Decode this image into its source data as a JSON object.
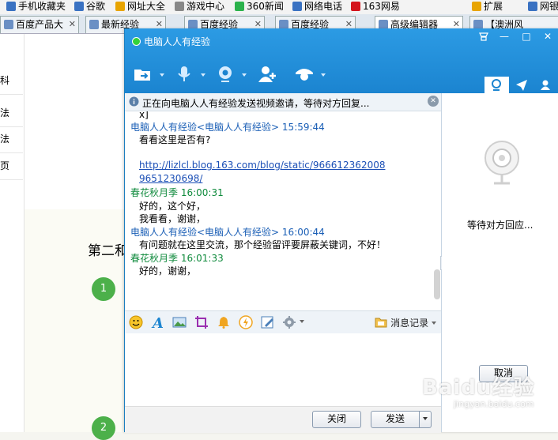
{
  "bookmarks": [
    {
      "label": "手机收藏夹",
      "color": "#3a72c2"
    },
    {
      "label": "谷歌",
      "color": "#3a72c2"
    },
    {
      "label": "网址大全",
      "color": "#e8a400"
    },
    {
      "label": "游戏中心",
      "color": "#888888"
    },
    {
      "label": "360新闻",
      "color": "#2bb24c"
    },
    {
      "label": "网络电话",
      "color": "#3a72c2"
    },
    {
      "label": "163网易",
      "color": "#d4141c"
    },
    {
      "label": "扩展",
      "color": "#e8a400"
    },
    {
      "label": "网银",
      "color": "#3a72c2"
    }
  ],
  "tabs": [
    {
      "label": "百度产品大",
      "close": "✕"
    },
    {
      "label": "最新经验",
      "close": "✕"
    },
    {
      "label": "百度经验",
      "close": "✕"
    },
    {
      "label": "百度经验",
      "close": "✕"
    },
    {
      "label": "高级编辑器",
      "close": "✕"
    },
    {
      "label": "【澳洲风",
      "close": ""
    }
  ],
  "background_page": {
    "nav_items": [
      "科",
      "法",
      "法",
      "页"
    ],
    "step_heading": "第二和",
    "step_numbers": [
      "1",
      "2"
    ]
  },
  "chat_window": {
    "title": "电脑人人有经验",
    "window_buttons": [
      "—",
      "□",
      "✕"
    ],
    "notice": "正在向电脑人人有经验发送视频邀请，等待对方回复...",
    "notice_close": "✕",
    "messages": [
      {
        "text": "x]",
        "style": "body"
      },
      {
        "text": "电脑人人有经验<电脑人人有经验> 15:59:44",
        "style": "sender-blue"
      },
      {
        "text": "看看这里是否有?",
        "style": "body"
      },
      {
        "text": "http://lizlcl.blog.163.com/blog/static/966612362008",
        "style": "link"
      },
      {
        "text": "9651230698/",
        "style": "link"
      },
      {
        "text": "春花秋月季 16:00:31",
        "style": "sender-green"
      },
      {
        "text": "好的，这个好，",
        "style": "body"
      },
      {
        "text": "我看看，谢谢，",
        "style": "body"
      },
      {
        "text": "电脑人人有经验<电脑人人有经验> 16:00:44",
        "style": "sender-blue"
      },
      {
        "text": "有问题就在这里交流，那个经验留评要屏蔽关键词，不好！",
        "style": "body"
      },
      {
        "text": "春花秋月季 16:01:33",
        "style": "sender-green"
      },
      {
        "text": "好的，谢谢，",
        "style": "body"
      }
    ],
    "toolbar": {
      "history_label": "消息记录",
      "icons": [
        "smiley-icon",
        "font-icon",
        "image-icon",
        "crop-icon",
        "bell-icon",
        "shake-icon",
        "edit-icon",
        "gear-icon"
      ]
    },
    "buttons": {
      "close_label": "关闭",
      "send_label": "发送"
    },
    "side_panel": {
      "waiting_text": "等待对方回应...",
      "cancel_label": "取消"
    }
  },
  "watermark": {
    "text": "Baidu经验",
    "sub": "jingyan.baidu.com"
  },
  "colors": {
    "title_blue": "#1b84d0",
    "sender_blue": "#1b5fb6",
    "sender_green": "#0f8a3c",
    "step_green": "#4cb04a"
  }
}
